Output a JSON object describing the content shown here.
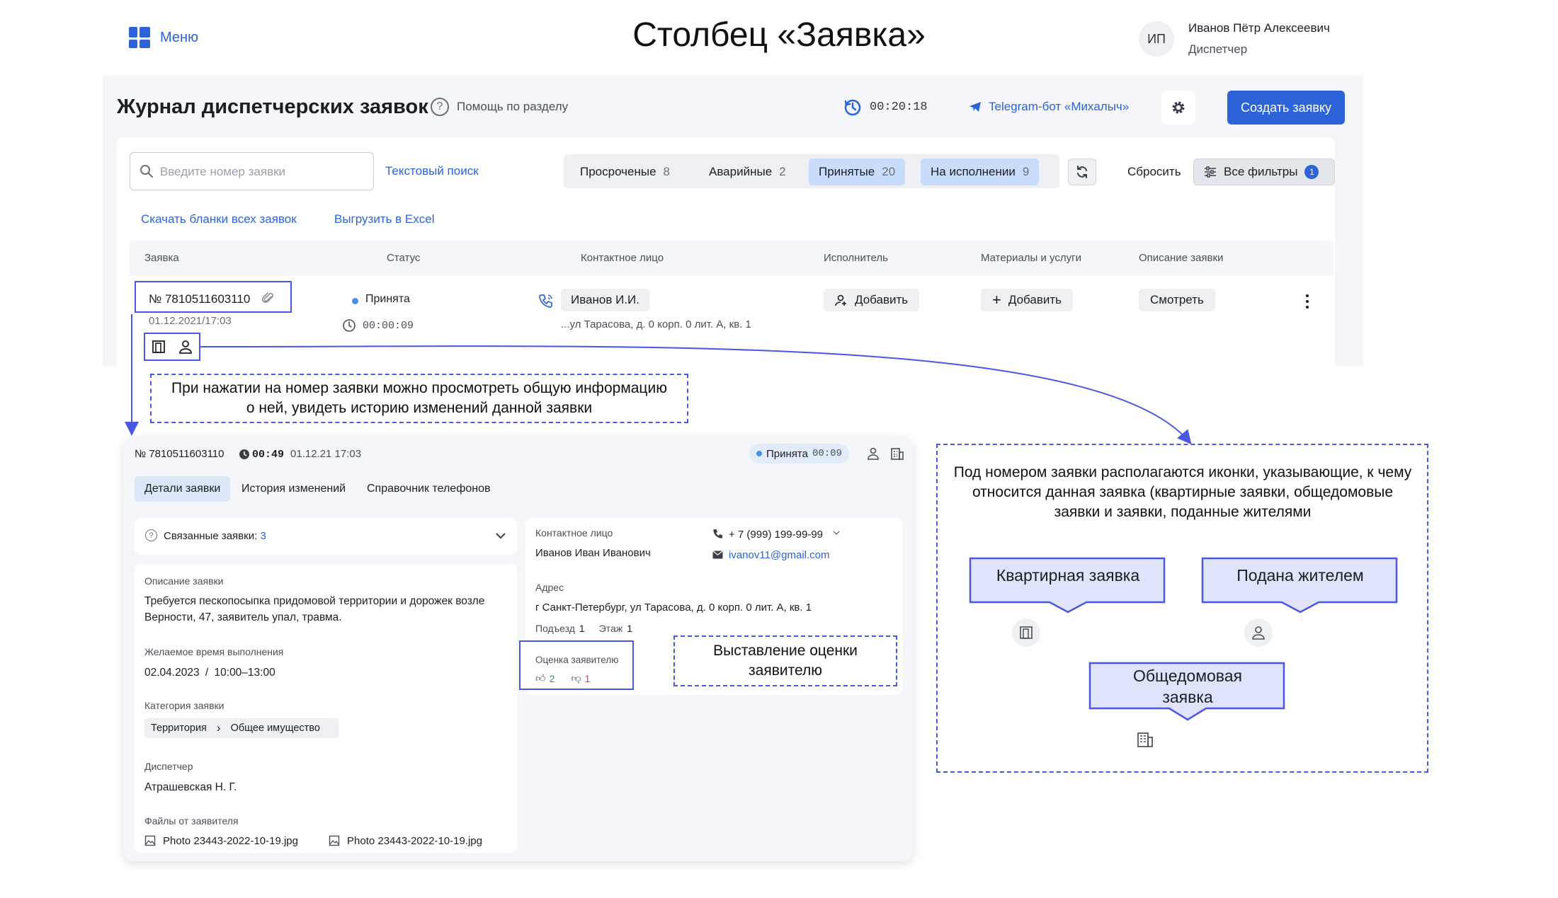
{
  "header": {
    "menu_label": "Меню",
    "heading": "Столбец «Заявка»",
    "user_initials": "ИП",
    "user_name": "Иванов Пётр Алексеевич",
    "user_role": "Диспетчер"
  },
  "journal": {
    "title": "Журнал диспетчерских заявок",
    "help_label": "Помощь по разделу",
    "timer": "00:20:18",
    "telegram_label": "Telegram-бот «Михалыч»",
    "create_label": "Создать заявку",
    "search_placeholder": "Введите номер заявки",
    "text_search_label": "Текстовый поиск",
    "filters": [
      {
        "label": "Просроченые",
        "count": "8",
        "active": false
      },
      {
        "label": "Аварийные",
        "count": "2",
        "active": false
      },
      {
        "label": "Принятые",
        "count": "20",
        "active": true
      },
      {
        "label": "На исполнении",
        "count": "9",
        "active": true
      }
    ],
    "reset_label": "Сбросить",
    "all_filters_label": "Все фильтры",
    "all_filters_count": "1",
    "download_label": "Скачать бланки всех заявок",
    "excel_label": "Выгрузить в Excel",
    "columns": [
      "Заявка",
      "Статус",
      "Контактное лицо",
      "Исполнитель",
      "Материалы и услуги",
      "Описание заявки"
    ],
    "row": {
      "number": "№ 7810511603110",
      "date": "01.12.2021/17:03",
      "status": "Принята",
      "status_time": "00:00:09",
      "contact": "Иванов И.И.",
      "address": "...ул Тарасова, д. 0 корп. 0 лит. А, кв. 1",
      "executor_btn": "Добавить",
      "materials_btn": "Добавить",
      "description_btn": "Смотреть"
    }
  },
  "notes": {
    "number_note": "При нажатии на номер заявки можно просмотреть общую информацию о ней, увидеть историю изменений данной заявки",
    "rating_note": "Выставление оценки заявителю",
    "icons_note": "Под номером заявки располагаются иконки, указывающие, к чему относится данная заявка (квартирные заявки, общедомовые заявки и заявки, поданные жителями",
    "cat_apartment": "Квартирная заявка",
    "cat_resident": "Подана жителем",
    "cat_building": "Общедомовая заявка"
  },
  "detail": {
    "number": "№ 7810511603110",
    "elapsed": "00:49",
    "date": "01.12.21 17:03",
    "status": "Принята",
    "status_time": "00:09",
    "tabs": [
      "Детали заявки",
      "История изменений",
      "Справочник телефонов"
    ],
    "related_label": "Связанные заявки:",
    "related_count": "3",
    "description_label": "Описание заявки",
    "description": "Требуется пескопосыпка придомовой территории и дорожек возле Верности, 47, заявитель упал, травма.",
    "desired_label": "Желаемое время выполнения",
    "desired_date": "02.04.2023",
    "desired_sep": "/",
    "desired_time": "10:00–13:00",
    "category_label": "Категория заявки",
    "category_1": "Территория",
    "category_2": "Общее имущество",
    "dispatcher_label": "Диспетчер",
    "dispatcher": "Атрашевская Н. Г.",
    "files_label": "Файлы от заявителя",
    "file_1": "Photo 23443-2022-10-19.jpg",
    "file_2": "Photo 23443-2022-10-19.jpg",
    "contact_label": "Контактное лицо",
    "contact_name": "Иванов Иван Иванович",
    "phone": "+ 7 (999) 199-99-99",
    "email": "ivanov11@gmail.com",
    "address_label": "Адрес",
    "address": "г Санкт-Петербург, ул Тарасова, д. 0 корп. 0 лит. А, кв. 1",
    "entrance_label": "Подъезд",
    "entrance": "1",
    "floor_label": "Этаж",
    "floor": "1",
    "rating_label": "Оценка заявителю",
    "likes": "2",
    "dislikes": "1"
  },
  "colors": {
    "accent": "#2d63d8",
    "annotation": "#4a57e3",
    "callout_fill": "#dfe3fb",
    "chip_active": "#c9dcfb",
    "status_dot": "#4c8cf0",
    "like": "#2f9e5a",
    "dislike": "#d9473a"
  }
}
